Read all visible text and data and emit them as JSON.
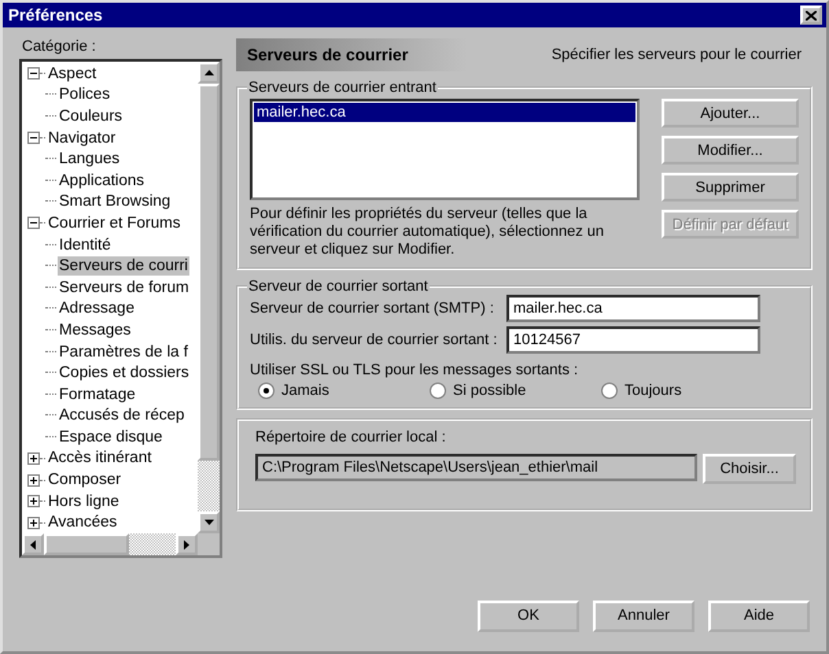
{
  "window": {
    "title": "Préférences"
  },
  "category_label": "Catégorie :",
  "tree": [
    {
      "label": "Aspect",
      "expanded": true,
      "selected": false,
      "children": [
        {
          "label": "Polices",
          "selected": false
        },
        {
          "label": "Couleurs",
          "selected": false
        }
      ]
    },
    {
      "label": "Navigator",
      "expanded": true,
      "selected": false,
      "children": [
        {
          "label": "Langues",
          "selected": false
        },
        {
          "label": "Applications",
          "selected": false
        },
        {
          "label": "Smart Browsing",
          "selected": false
        }
      ]
    },
    {
      "label": "Courrier et Forums",
      "expanded": true,
      "selected": false,
      "children": [
        {
          "label": "Identité",
          "selected": false
        },
        {
          "label": "Serveurs de courri",
          "selected": true
        },
        {
          "label": "Serveurs de forum",
          "selected": false
        },
        {
          "label": "Adressage",
          "selected": false
        },
        {
          "label": "Messages",
          "selected": false
        },
        {
          "label": "Paramètres de la f",
          "selected": false
        },
        {
          "label": "Copies et dossiers",
          "selected": false
        },
        {
          "label": "Formatage",
          "selected": false
        },
        {
          "label": "Accusés de récep",
          "selected": false
        },
        {
          "label": "Espace disque",
          "selected": false
        }
      ]
    },
    {
      "label": "Accès itinérant",
      "expanded": false,
      "selected": false
    },
    {
      "label": "Composer",
      "expanded": false,
      "selected": false
    },
    {
      "label": "Hors ligne",
      "expanded": false,
      "selected": false
    },
    {
      "label": "Avancées",
      "expanded": false,
      "selected": false
    }
  ],
  "panel": {
    "title": "Serveurs de courrier",
    "subtitle": "Spécifier les serveurs pour le courrier"
  },
  "incoming": {
    "legend": "Serveurs de courrier entrant",
    "servers": [
      {
        "name": "mailer.hec.ca",
        "selected": true
      }
    ],
    "buttons": [
      {
        "label": "Ajouter...",
        "disabled": false
      },
      {
        "label": "Modifier...",
        "disabled": false
      },
      {
        "label": "Supprimer",
        "disabled": false
      },
      {
        "label": "Définir par défaut",
        "disabled": true
      }
    ],
    "hint": "Pour définir les propriétés du serveur (telles que la vérification du courrier automatique), sélectionnez un serveur et cliquez sur Modifier."
  },
  "outgoing": {
    "legend": "Serveur de courrier sortant",
    "fields": [
      {
        "label": "Serveur de courrier sortant (SMTP) :",
        "value": "mailer.hec.ca"
      },
      {
        "label": "Utilis. du serveur de courrier sortant :",
        "value": "10124567"
      }
    ],
    "ssl_label": "Utiliser SSL ou TLS pour les messages sortants :",
    "ssl_options": [
      {
        "label": "Jamais",
        "selected": true
      },
      {
        "label": "Si possible",
        "selected": false
      },
      {
        "label": "Toujours",
        "selected": false
      }
    ]
  },
  "local": {
    "label": "Répertoire de courrier local :",
    "path": "C:\\Program Files\\Netscape\\Users\\jean_ethier\\mail",
    "button": "Choisir..."
  },
  "footer_buttons": [
    "OK",
    "Annuler",
    "Aide"
  ]
}
